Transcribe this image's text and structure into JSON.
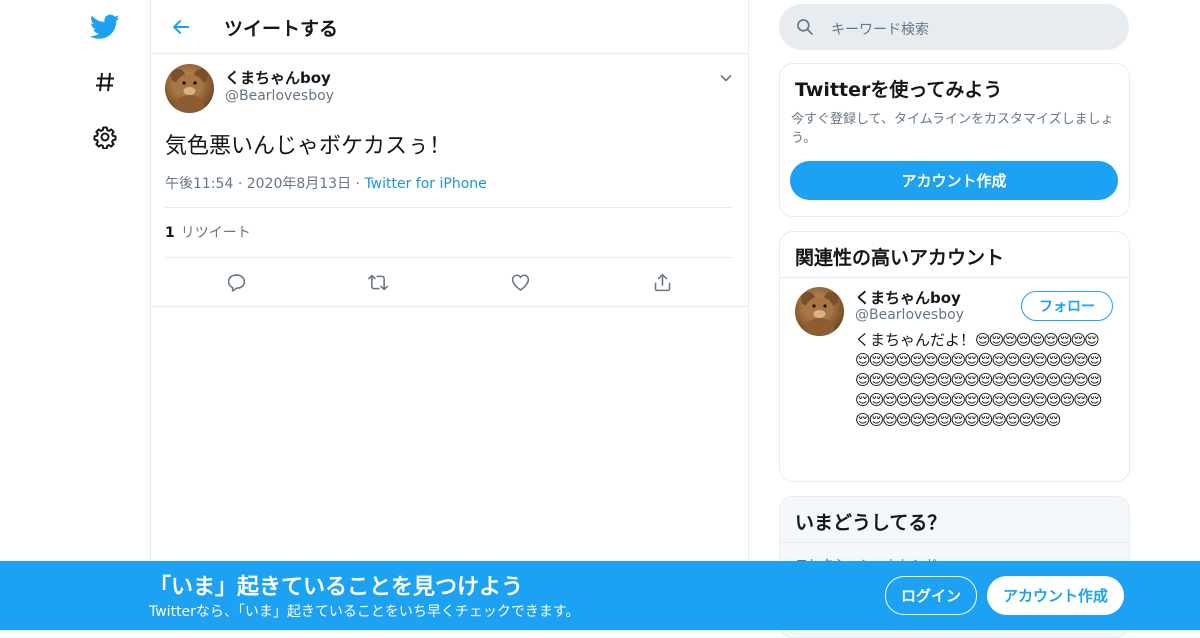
{
  "colors": {
    "accent": "#1da1f2",
    "secondary_text": "#657786",
    "border": "#e6ecf0"
  },
  "nav": {
    "icons": [
      "twitter-bird-icon",
      "hashtag-icon",
      "gear-icon"
    ]
  },
  "header": {
    "title": "ツイートする",
    "back_icon": "arrow-left-icon"
  },
  "tweet": {
    "author_name": "くまちゃんboy",
    "author_handle": "@Bearlovesboy",
    "text": "気色悪いんじゃボケカスぅ！",
    "time": "午後11:54",
    "date": "2020年8月13日",
    "source": "Twitter for iPhone",
    "retweet_count": "1",
    "retweet_label": "リツイート",
    "actions": [
      "reply-icon",
      "retweet-icon",
      "like-icon",
      "share-icon"
    ]
  },
  "search": {
    "placeholder": "キーワード検索"
  },
  "signup_card": {
    "title": "Twitterを使ってみよう",
    "description": "今すぐ登録して、タイムラインをカスタマイズしましょう。",
    "button": "アカウント作成"
  },
  "related": {
    "title": "関連性の高いアカウント",
    "name": "くまちゃんboy",
    "handle": "@Bearlovesboy",
    "follow": "フォロー",
    "bio_text": "くまちゃんだよ！",
    "bio_emoji": "😌😌😌😌😌😌😌😌😌😌😌😌😌😌😌😌😌😌😌😌😌😌😌😌😌😌😌😌😌😌😌😌😌😌😌😌😌😌😌😌😌😌😌😌😌😌😌😌😌😌😌😌😌😌😌😌😌😌😌😌😌😌😌😌😌😌😌😌😌😌😌😌😌😌😌😌😌😌"
  },
  "trends": {
    "title": "いまどうしてる？",
    "row": "コレクション・トレンド"
  },
  "banner": {
    "title": "「いま」起きていることを見つけよう",
    "subtitle": "Twitterなら、「いま」起きていることをいち早くチェックできます。",
    "login": "ログイン",
    "signup": "アカウント作成"
  }
}
